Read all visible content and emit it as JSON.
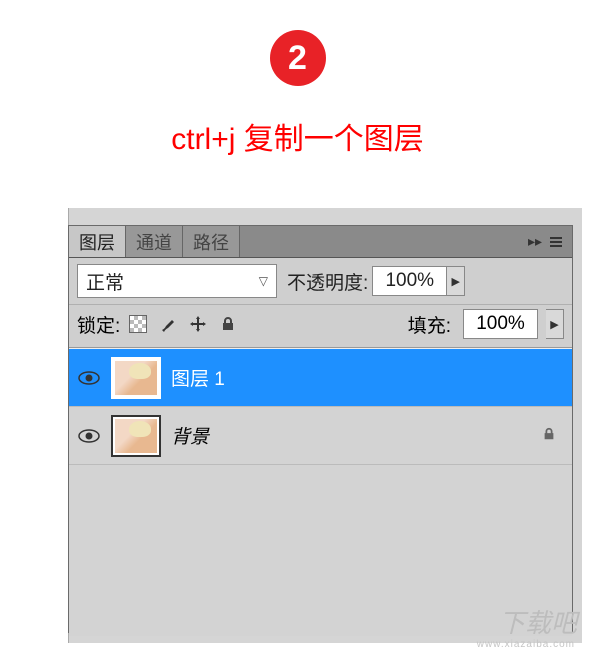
{
  "step": {
    "number": "2",
    "caption": "ctrl+j 复制一个图层"
  },
  "panel": {
    "tabs": [
      {
        "label": "图层",
        "active": true
      },
      {
        "label": "通道",
        "active": false
      },
      {
        "label": "路径",
        "active": false
      }
    ],
    "blend_mode": "正常",
    "opacity_label": "不透明度:",
    "opacity_value": "100%",
    "lock_label": "锁定:",
    "fill_label": "填充:",
    "fill_value": "100%"
  },
  "layers": [
    {
      "name": "图层 1",
      "selected": true,
      "locked": false
    },
    {
      "name": "背景",
      "selected": false,
      "locked": true
    }
  ],
  "watermark": {
    "main": "下载吧",
    "sub": "www.xiazaiba.com"
  }
}
